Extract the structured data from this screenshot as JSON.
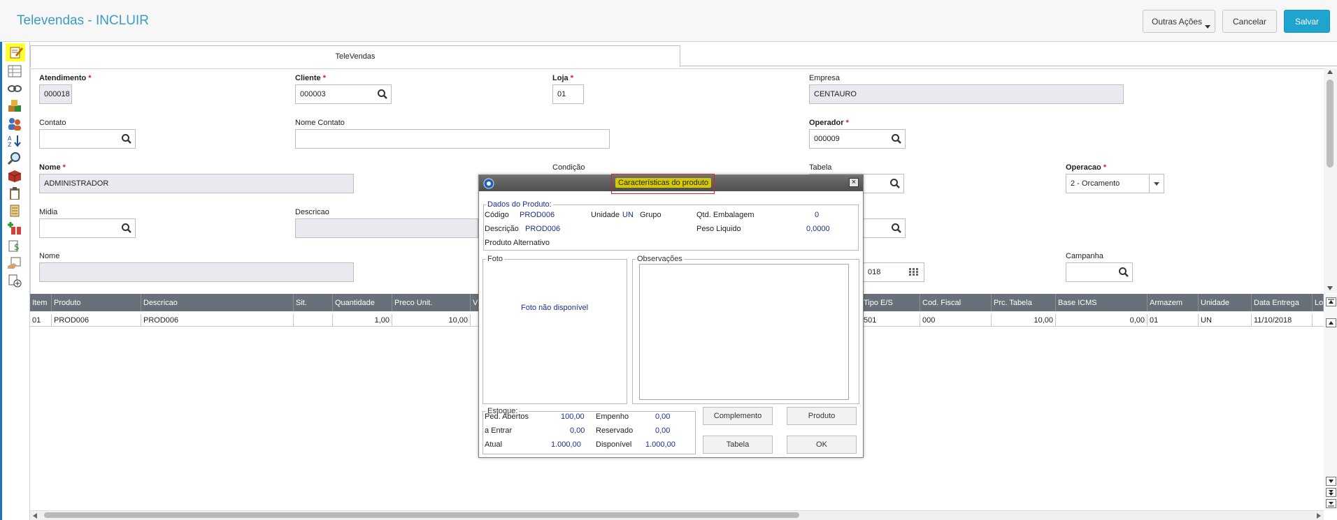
{
  "header": {
    "title": "Televendas - INCLUIR",
    "buttons": {
      "outras_acoes": "Outras Ações",
      "cancelar": "Cancelar",
      "salvar": "Salvar"
    }
  },
  "toolbar_icons": [
    "edit-icon",
    "list-icon",
    "link-icon",
    "boxes-icon",
    "users-icon",
    "sort-icon",
    "zoom-icon",
    "package-icon",
    "clipboard-icon",
    "scroll-icon",
    "add-gift-icon",
    "money-doc-icon",
    "hand-doc-icon",
    "add-doc-icon"
  ],
  "tab": {
    "label": "TeleVendas"
  },
  "form": {
    "atendimento": {
      "label": "Atendimento",
      "value": "000018"
    },
    "cliente": {
      "label": "Cliente",
      "value": "000003"
    },
    "loja": {
      "label": "Loja",
      "value": "01"
    },
    "empresa": {
      "label": "Empresa",
      "value": "CENTAURO"
    },
    "contato": {
      "label": "Contato",
      "value": ""
    },
    "nome_contato": {
      "label": "Nome Contato",
      "value": ""
    },
    "operador": {
      "label": "Operador",
      "value": "000009"
    },
    "nome": {
      "label": "Nome",
      "value": "ADMINISTRADOR"
    },
    "condicao": {
      "label": "Condição"
    },
    "tabela": {
      "label": "Tabela"
    },
    "operacao": {
      "label": "Operacao",
      "value": "2 - Orcamento"
    },
    "midia": {
      "label": "Midia",
      "value": ""
    },
    "descricao": {
      "label": "Descricao",
      "value": ""
    },
    "nome2": {
      "label": "Nome",
      "value": ""
    },
    "data_fragment": "018",
    "campanha": {
      "label": "Campanha",
      "value": ""
    }
  },
  "grid": {
    "columns": [
      "Item",
      "Produto",
      "Descricao",
      "Sit.",
      "Quantidade",
      "Preco Unit.",
      "Vl",
      "Tipo E/S",
      "Cod. Fiscal",
      "Prc. Tabela",
      "Base ICMS",
      "Armazem",
      "Unidade",
      "Data Entrega",
      "Lo"
    ],
    "row": {
      "item": "01",
      "produto": "PROD006",
      "descricao": "PROD006",
      "sit": "",
      "quantidade": "1,00",
      "preco_unit": "10,00",
      "tipo_es": "501",
      "cod_fiscal": "000",
      "prc_tabela": "10,00",
      "base_icms": "0,00",
      "armazem": "01",
      "unidade": "UN",
      "data_entrega": "11/10/2018"
    }
  },
  "dialog": {
    "title": "Características do produto",
    "dados_label": "Dados do Produto:",
    "codigo_label": "Código",
    "codigo_value": "PROD006",
    "unidade_label": "Unidade",
    "unidade_value": "UN",
    "grupo_label": "Grupo",
    "qtd_emb_label": "Qtd. Embalagem",
    "qtd_emb_value": "0",
    "descricao_label": "Descrição",
    "descricao_value": "PROD006",
    "peso_label": "Peso Liquido",
    "peso_value": "0,0000",
    "prod_alt_label": "Produto Alternativo",
    "foto_label": "Foto",
    "foto_text": "Foto não disponível",
    "obs_label": "Observações",
    "estoque_label": "Estoque:",
    "ped_abertos_label": "Ped. Abertos",
    "ped_abertos_value": "100,00",
    "empenho_label": "Empenho",
    "empenho_value": "0,00",
    "a_entrar_label": "a Entrar",
    "a_entrar_value": "0,00",
    "reservado_label": "Reservado",
    "reservado_value": "0,00",
    "atual_label": "Atual",
    "atual_value": "1.000,00",
    "disponivel_label": "Disponível",
    "disponivel_value": "1.000,00",
    "buttons": {
      "complemento": "Complemento",
      "produto": "Produto",
      "tabela": "Tabela",
      "ok": "OK"
    }
  },
  "colors": {
    "accent": "#1fa3cf",
    "title": "#3a9cc7",
    "grid_header": "#687179",
    "dialog_value": "#1c2e8c",
    "highlight": "#e7e400",
    "required": "#d21b1b"
  }
}
